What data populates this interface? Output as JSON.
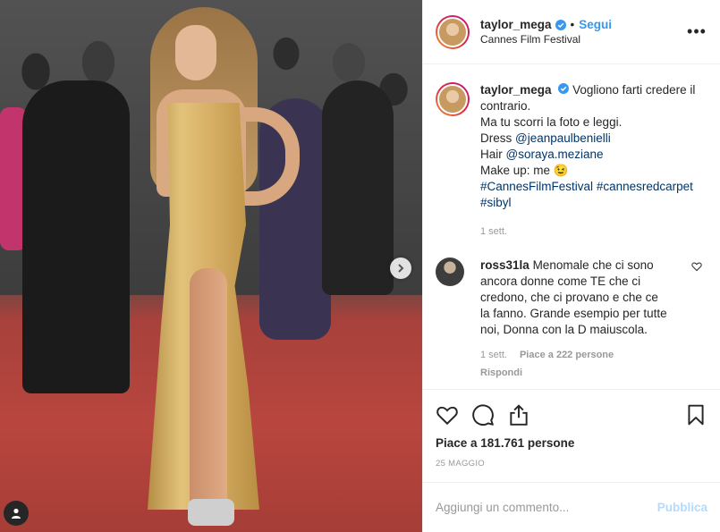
{
  "post": {
    "username": "taylor_mega",
    "follow_label": "Segui",
    "separator": "•",
    "location": "Cannes Film Festival",
    "more_label": "•••"
  },
  "caption": {
    "username": "taylor_mega",
    "line1": "Vogliono farti credere il contrario.",
    "line2": "Ma tu scorri la foto e leggi.",
    "dress_prefix": "Dress ",
    "dress_link": "@jeanpaulbenielli",
    "hair_prefix": "Hair ",
    "hair_link": "@soraya.meziane",
    "makeup": "Make up: me 😉",
    "hashtags1": "#CannesFilmFestival",
    "hashtags2": "#cannesredcarpet",
    "hashtags3": "#sibyl",
    "time": "1 sett."
  },
  "comment": {
    "username": "ross31la",
    "text": "Menomale che ci sono ancora donne come TE che ci credono, che ci provano e che ce la fanno. Grande esempio per tutte noi, Donna con la D maiuscola.",
    "time": "1 sett.",
    "likes": "Piace a 222 persone",
    "reply_label": "Rispondi"
  },
  "stats": {
    "likes": "Piace a 181.761 persone",
    "date": "25 MAGGIO"
  },
  "composer": {
    "placeholder": "Aggiungi un commento...",
    "publish_label": "Pubblica"
  },
  "colors": {
    "accent": "#3897f0",
    "link": "#003569",
    "muted": "#999999"
  },
  "icons": [
    "chevron-right-icon",
    "user-tag-icon",
    "verified-icon",
    "more-icon",
    "heart-icon",
    "comment-icon",
    "share-icon",
    "bookmark-icon"
  ]
}
